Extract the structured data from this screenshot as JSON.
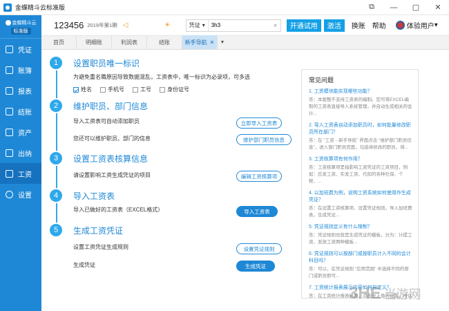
{
  "window": {
    "title": "金蝶精斗云标准版",
    "controls": [
      "⧉",
      "—",
      "▢",
      "✕"
    ]
  },
  "sidebar": {
    "brand_name": "金蝶精斗云",
    "brand_edition": "标准版",
    "items": [
      {
        "label": "凭证"
      },
      {
        "label": "账簿"
      },
      {
        "label": "报表"
      },
      {
        "label": "结账"
      },
      {
        "label": "资产"
      },
      {
        "label": "出纳"
      },
      {
        "label": "工资"
      },
      {
        "label": "设置"
      }
    ]
  },
  "header": {
    "company": "123456",
    "period": "2019年第1期",
    "search_type": "凭证",
    "search_value": "3h3",
    "trial_button": "开通试用",
    "activate_button": "激活",
    "switch_account": "换账",
    "help": "帮助",
    "user": "体验用户"
  },
  "tabs": [
    {
      "label": "首页"
    },
    {
      "label": "明细账"
    },
    {
      "label": "利润表"
    },
    {
      "label": "结账"
    },
    {
      "label": "新手导航",
      "active": true
    }
  ],
  "steps": [
    {
      "num": "1",
      "title": "设置职员唯一标识",
      "desc": "为避免重名職原因导致数据混乱，工资表中，唯一标识为必录项，可多选",
      "checks": [
        {
          "label": "姓名",
          "checked": true
        },
        {
          "label": "手机号",
          "checked": false
        },
        {
          "label": "工号",
          "checked": false
        },
        {
          "label": "身份证号",
          "checked": false
        }
      ]
    },
    {
      "num": "2",
      "title": "维护职员、部门信息",
      "desc1": "导入工资表可自动添加职员",
      "button1": "立即导入工资表",
      "desc2": "您还可以维护职员、部门的信息",
      "button2": "维护部门职员信息"
    },
    {
      "num": "3",
      "title": "设置工资表核算信息",
      "desc": "请设置影响工资生成凭证的项目",
      "button": "编辑工资核算项"
    },
    {
      "num": "4",
      "title": "导入工资表",
      "desc": "导入已做好的工资表（EXCEL格式）",
      "button": "导入工资表"
    },
    {
      "num": "5",
      "title": "生成工资凭证",
      "desc1": "设置工资凭证生成规则",
      "button1": "设置凭证规则",
      "desc2": "生成凭证",
      "button2": "生成凭证"
    }
  ],
  "faq": {
    "title": "常见问题",
    "items": [
      {
        "q": "1. 工资模块能实现哪些功能？",
        "a": "答：本版整不支持工资表的编制。您可将EXCEL编制的工资表直接导入系统管理，并自动生成相关的会计..."
      },
      {
        "q": "2. 导入工资表自动添加职员时，如何批量修改职员所在部门？",
        "a": "答：在 \"工资→新手导航\" 界面点击 \"维护部门职员信息\"，进入部门职员页面，勾选待修改的职员，将..."
      },
      {
        "q": "3. 工资核算项有何作用？",
        "a": "答：工资核算项是指影响工资凭证的工资项目，例如：应发工资、实发工资、代扣的各种社保、个税、..."
      },
      {
        "q": "4. 以加班费为例，说明工资系统如何使用作生成凭证？",
        "a": "答：在设置工资核算项、设置凭证规则，导入加班费表，生成凭证..."
      },
      {
        "q": "5. 凭证规则定义有什么限制？",
        "a": "答：凭证规则也就是生成凭证的模板，分为：计提工资、发放工资两种模板..."
      },
      {
        "q": "6. 凭证规则可以按部门或按职员计入不同的会计科目吗？",
        "a": "答：可以，在凭证规则 \"应用范围\" 中选择不同的部门或职员即可..."
      },
      {
        "q": "7. 工资统计报表展示内容如何自定义？",
        "a": "答：在工资统计报表界面，点击左上角的设置，可以设置工资统计表显示的项目等。"
      }
    ]
  },
  "watermark": {
    "logo": "3HE",
    "text": "当游网"
  },
  "colors": {
    "sidebar": "#1e88d6",
    "accent": "#14a0e6",
    "step": "#2ea8ec"
  }
}
